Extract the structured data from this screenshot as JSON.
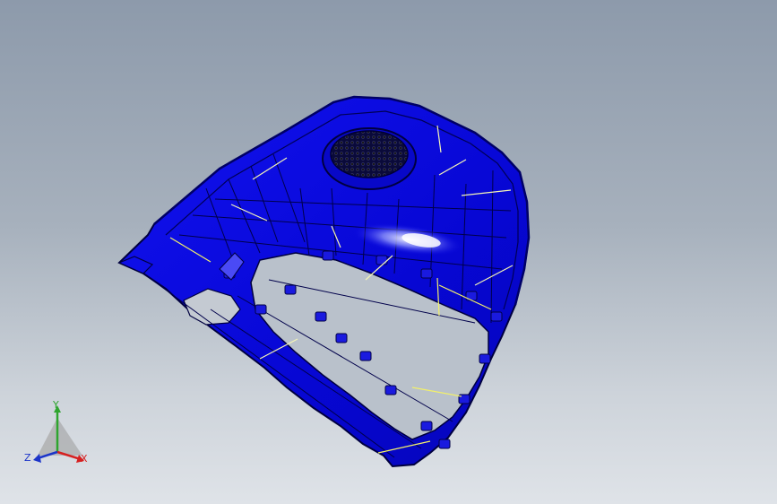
{
  "scene": {
    "background_top": "#8d9aab",
    "background_bottom": "#dfe3e8",
    "model_color": "#0a0ae6",
    "edge_color": "#000055",
    "highlight_color": "#ffffff",
    "sketch_line_color": "#f2f06a",
    "speaker_grille_color": "#1a1a1a"
  },
  "triad": {
    "x_label": "X",
    "y_label": "Y",
    "z_label": "Z",
    "x_color": "#d62020",
    "y_color": "#2fa52f",
    "z_color": "#1c35c9"
  }
}
